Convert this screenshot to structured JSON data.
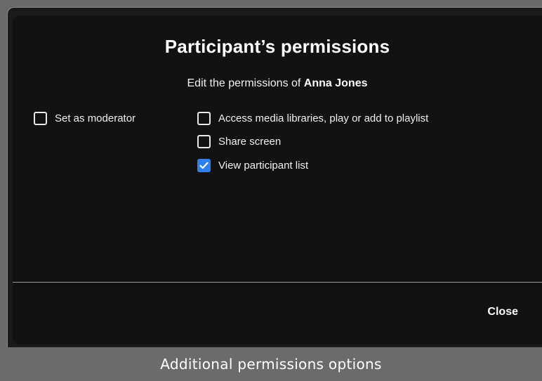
{
  "dialog": {
    "title": "Participant’s permissions",
    "subtitle_prefix": "Edit the permissions of ",
    "participant_name": "Anna Jones",
    "close_label": "Close"
  },
  "permissions": [
    {
      "label": "Set as moderator",
      "checked": false
    },
    {
      "label": "Access media libraries, play or add to playlist",
      "checked": false
    },
    {
      "label": "Share screen",
      "checked": false
    },
    {
      "label": "View participant list",
      "checked": true
    }
  ],
  "caption": "Additional permissions options",
  "colors": {
    "accent": "#2f80ed",
    "dialog_bg": "#121212",
    "caption_bg": "#6b6b6b"
  },
  "icons": {
    "checkmark": "check-icon"
  }
}
